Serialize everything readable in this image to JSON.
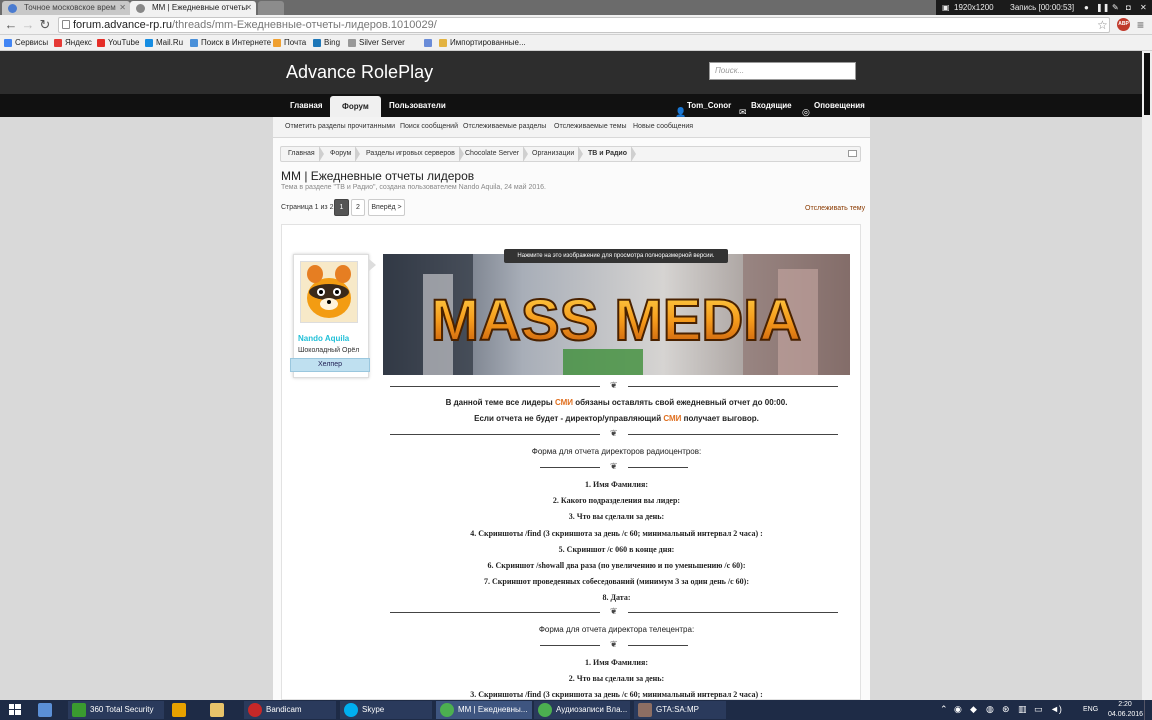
{
  "browser": {
    "tabs": [
      {
        "label": "Точное московское врем",
        "active": false
      },
      {
        "label": "MM | Ежедневные отчеты",
        "active": true
      },
      {
        "label": "",
        "active": false
      }
    ],
    "recorder": {
      "resolution": "1920x1200",
      "status": "Запись [00:00:53]"
    },
    "url": {
      "host": "forum.advance-rp.ru",
      "path": "/threads/mm-Ежедневные-отчеты-лидеров.1010029/"
    },
    "bookmarks": [
      {
        "label": "Сервисы",
        "color": "#4285f4"
      },
      {
        "label": "Яндекс",
        "color": "#e53935"
      },
      {
        "label": "YouTube",
        "color": "#e52d27"
      },
      {
        "label": "Mail.Ru",
        "color": "#168de2"
      },
      {
        "label": "Поиск в Интернете",
        "color": "#4a90d9"
      },
      {
        "label": "Почта",
        "color": "#f0a030"
      },
      {
        "label": "Bing",
        "color": "#1e77b8"
      },
      {
        "label": "Silver Server",
        "color": "#999999"
      },
      {
        "label": "",
        "color": "#6a8cd8"
      },
      {
        "label": "Импортированные...",
        "color": "#e3b341"
      }
    ]
  },
  "site": {
    "logo": "Advance RolePlay",
    "search_placeholder": "Поиск...",
    "nav": {
      "home": "Главная",
      "forum": "Форум",
      "users": "Пользователи"
    },
    "user": {
      "name": "Tom_Conor",
      "inbox": "Входящие",
      "alerts": "Оповещения"
    },
    "subnav": [
      "Отметить разделы прочитанными",
      "Поиск сообщений",
      "Отслеживаемые разделы",
      "Отслеживаемые темы",
      "Новые сообщения"
    ]
  },
  "breadcrumb": [
    "Главная",
    "Форум",
    "Разделы игровых серверов",
    "Chocolate Server",
    "Организации",
    "ТВ и Радио"
  ],
  "thread": {
    "title": "MM | Ежедневные отчеты лидеров",
    "meta": "Тема в разделе \"ТВ и Радио\", создана пользователем Nando Aquila, 24 май 2016.",
    "pager": {
      "label": "Страница 1 из 2",
      "pages": [
        "1",
        "2"
      ],
      "next": "Вперёд >"
    },
    "watch": "Отслеживать тему"
  },
  "post": {
    "author": {
      "name": "Nando Aquila",
      "title": "Шоколадный Орёл",
      "badge": "Хелпер"
    },
    "tooltip": "Нажмите на это изображение для просмотра полноразмерной версии.",
    "banner_text": "MASS MEDIA",
    "intro": {
      "l1a": "В данной теме все лидеры ",
      "l1b": "СМИ",
      "l1c": " обязаны оставлять свой ежедневный отчет до 00:00.",
      "l2a": "Если отчета не будет - директор/управляющий ",
      "l2b": "СМИ",
      "l2c": " получает выговор."
    },
    "form1_title": "Форма для отчета директоров радиоцентров:",
    "form1_items": [
      "1. Имя Фамилия:",
      "2. Какого подразделения вы лидер:",
      "3. Что вы сделали за день:",
      "4. Скриншоты /find (3 скриншота за день /c 60; минимальный интервал 2 часа) :",
      "5. Скриншот /c 060 в конце дня:",
      "6. Скриншот /showall два раза (по увеличению и по уменьшению /c 60):",
      "7. Скриншот проведенных собеседований (минимум 3 за один день /c 60):",
      "8. Дата:"
    ],
    "form2_title": "Форма для отчета директора телецентра:",
    "form2_items": [
      "1. Имя Фамилия:",
      "2. Что вы сделали за день:",
      "3. Скриншоты /find (3 скриншота за день /c 60; минимальный интервал 2 часа) :"
    ]
  },
  "taskbar": {
    "items": [
      {
        "label": "360 Total Security",
        "color": "#3a9b2f"
      },
      {
        "label": "",
        "color": "#e8a200"
      },
      {
        "label": "",
        "color": "#e9c46a"
      },
      {
        "label": "Bandicam",
        "color": "#c62828"
      },
      {
        "label": "Skype",
        "color": "#00aff0"
      },
      {
        "label": "MM | Ежедневны...",
        "color": "#4caf50"
      },
      {
        "label": "Аудиозаписи Вла...",
        "color": "#4caf50"
      },
      {
        "label": "GTA:SA:MP",
        "color": "#8d6e63"
      }
    ],
    "lang": "ENG",
    "time": "2:20",
    "date": "04.06.2016"
  }
}
